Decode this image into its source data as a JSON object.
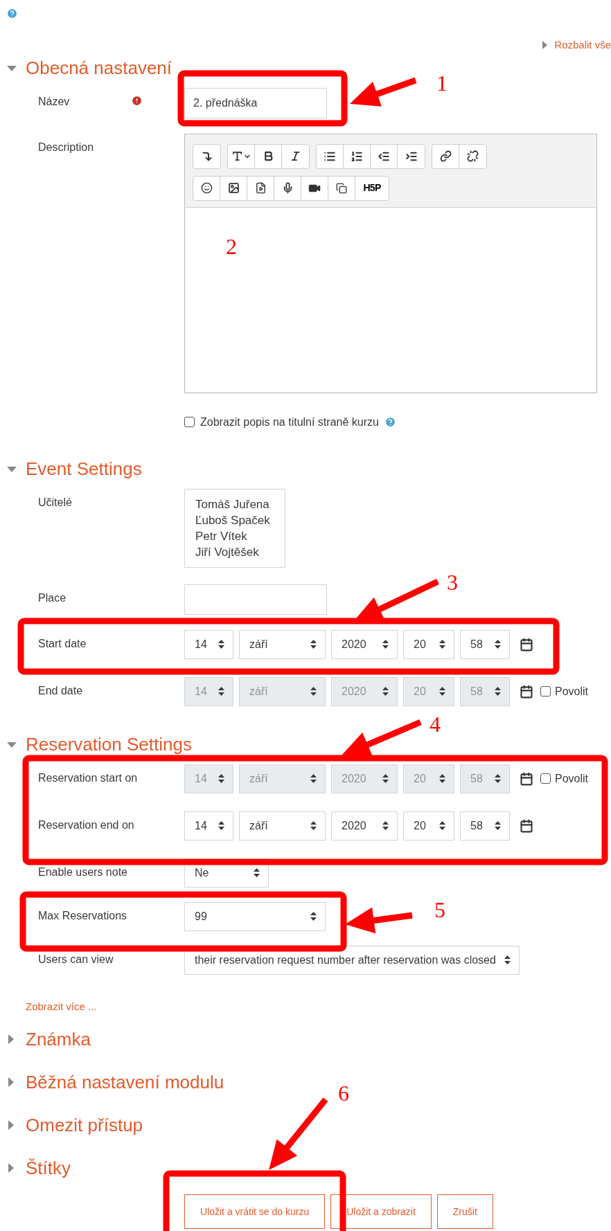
{
  "expand_all": "Rozbalit vše",
  "sections": [
    {
      "title": "Obecná nastavení",
      "expanded": true,
      "fields": [
        {
          "kind": "text",
          "label": "Název",
          "required": true,
          "value": "2. přednáška"
        },
        {
          "kind": "editor",
          "label": "Description",
          "h5p": "H5P"
        },
        {
          "kind": "checkbox",
          "label": "Zobrazit popis na titulní straně kurzu",
          "checked": false,
          "help": true
        }
      ]
    },
    {
      "title": "Event Settings",
      "expanded": true,
      "fields": [
        {
          "kind": "list",
          "label": "Učitelé",
          "items": [
            "Tomáš Juřena",
            "Ľuboš Spaček",
            "Petr Vítek",
            "Jiří Vojtěšek"
          ]
        },
        {
          "kind": "text",
          "label": "Place",
          "required": false
        },
        {
          "kind": "date",
          "label": "Start date",
          "disabled": false,
          "parts": [
            "14",
            "září",
            "2020",
            "20",
            "58"
          ]
        },
        {
          "kind": "date",
          "label": "End date",
          "disabled": true,
          "parts": [
            "14",
            "září",
            "2020",
            "20",
            "58"
          ],
          "enable": {
            "label": "Povolit",
            "checked": false
          }
        }
      ]
    },
    {
      "title": "Reservation Settings",
      "expanded": true,
      "fields": [
        {
          "kind": "date",
          "label": "Reservation start on",
          "disabled": true,
          "parts": [
            "14",
            "září",
            "2020",
            "20",
            "58"
          ],
          "enable": {
            "label": "Povolit",
            "checked": false
          }
        },
        {
          "kind": "date",
          "label": "Reservation end on",
          "disabled": false,
          "parts": [
            "14",
            "září",
            "2020",
            "20",
            "58"
          ]
        },
        {
          "kind": "select",
          "label": "Enable users note",
          "value": "Ne"
        },
        {
          "kind": "select",
          "label": "Max Reservations",
          "value": "99"
        },
        {
          "kind": "select",
          "label": "Users can view",
          "value": "their reservation request number after reservation was closed"
        }
      ],
      "more_link": "Zobrazit více ..."
    },
    {
      "title": "Známka",
      "expanded": false
    },
    {
      "title": "Běžná nastavení modulu",
      "expanded": false
    },
    {
      "title": "Omezit přístup",
      "expanded": false
    },
    {
      "title": "Štítky",
      "expanded": false
    }
  ],
  "buttons": [
    "Uložit a vrátit se do kurzu",
    "Uložit a zobrazit",
    "Zrušit"
  ],
  "annotations": [
    {
      "label": "1"
    },
    {
      "label": "2"
    },
    {
      "label": "3"
    },
    {
      "label": "4"
    },
    {
      "label": "5"
    },
    {
      "label": "6"
    }
  ]
}
